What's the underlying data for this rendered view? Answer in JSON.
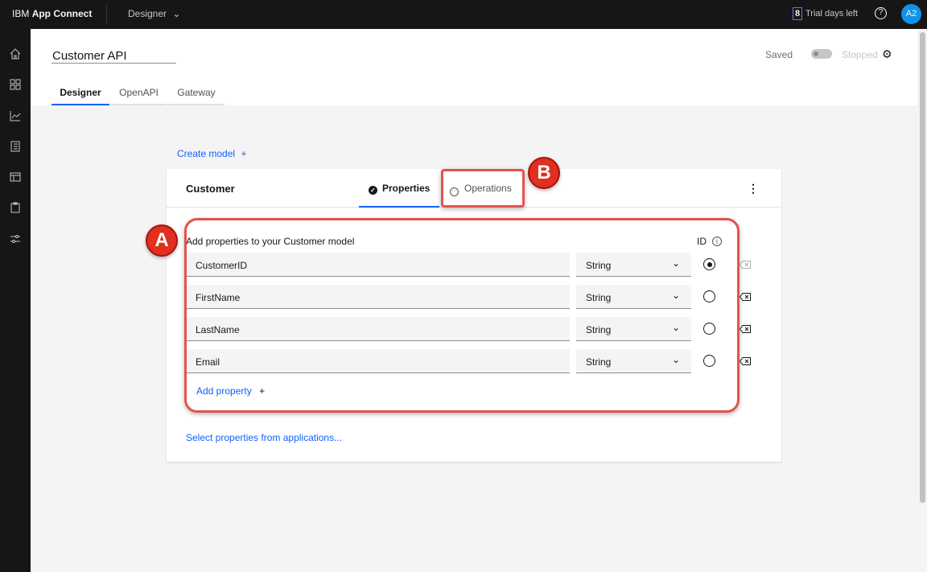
{
  "topbar": {
    "brand_prefix": "IBM",
    "brand_name": "App Connect",
    "menu": "Designer",
    "trial_days": "8",
    "trial_text": "Trial days left",
    "avatar": "A2"
  },
  "sidebar": {
    "items": [
      "home-icon",
      "dashboard-icon",
      "chart-icon",
      "catalog-icon",
      "template-icon",
      "clipboard-icon",
      "settings-sliders-icon"
    ]
  },
  "header": {
    "title": "Customer API",
    "saved": "Saved",
    "status": "Stopped",
    "tabs": [
      {
        "label": "Designer",
        "active": true
      },
      {
        "label": "OpenAPI"
      },
      {
        "label": "Gateway"
      }
    ]
  },
  "main": {
    "create_model": "Create model",
    "model": {
      "name": "Customer",
      "tabs": [
        {
          "label": "Properties",
          "active": true
        },
        {
          "label": "Operations"
        }
      ],
      "intro": "Add properties to your Customer model",
      "id_label": "ID",
      "properties": [
        {
          "name": "CustomerID",
          "type": "String",
          "id": true
        },
        {
          "name": "FirstName",
          "type": "String",
          "id": false
        },
        {
          "name": "LastName",
          "type": "String",
          "id": false
        },
        {
          "name": "Email",
          "type": "String",
          "id": false
        }
      ],
      "add_property": "Add property",
      "select_from_apps": "Select properties from applications..."
    }
  },
  "annotations": {
    "a": "A",
    "b": "B",
    "color": "#e5534b"
  }
}
